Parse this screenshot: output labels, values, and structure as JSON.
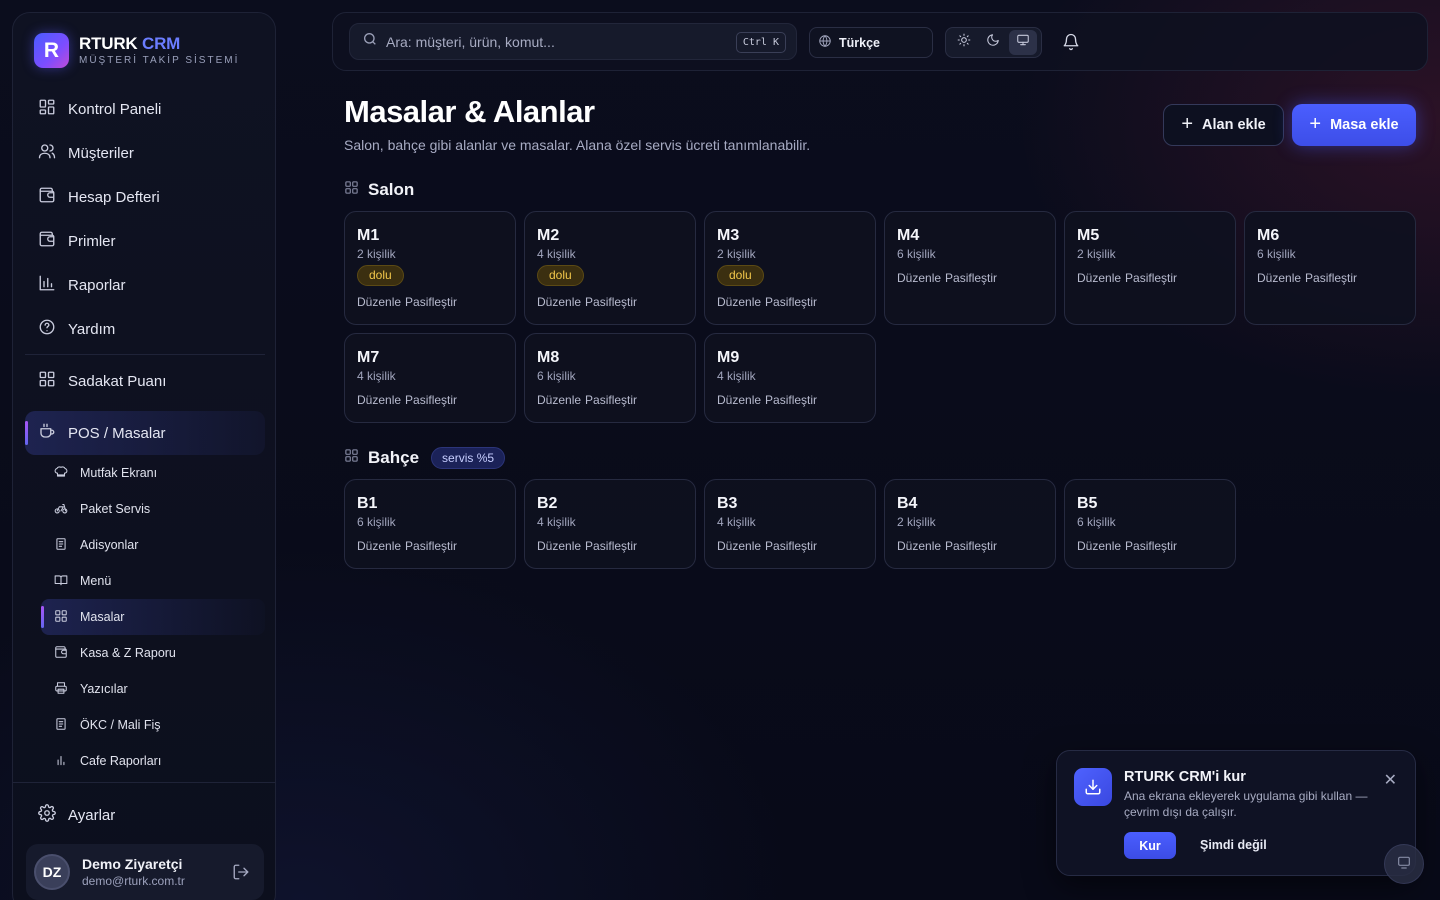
{
  "brand": {
    "logo_letter": "R",
    "name": "RTURK",
    "name_accent": "CRM",
    "subtitle": "MÜŞTERİ TAKİP SİSTEMİ"
  },
  "sidebar": {
    "items": [
      {
        "label": "Kontrol Paneli",
        "icon": "dashboard-icon"
      },
      {
        "label": "Müşteriler",
        "icon": "users-icon"
      },
      {
        "label": "Hesap Defteri",
        "icon": "wallet-icon"
      },
      {
        "label": "Primler",
        "icon": "wallet-icon"
      },
      {
        "label": "Raporlar",
        "icon": "bar-chart-icon"
      },
      {
        "label": "Yardım",
        "icon": "help-icon"
      }
    ],
    "loyalty": {
      "label": "Sadakat Puanı",
      "icon": "grid-icon"
    },
    "pos": {
      "label": "POS / Masalar",
      "icon": "coffee-icon",
      "children": [
        {
          "label": "Mutfak Ekranı",
          "icon": "chef-hat-icon"
        },
        {
          "label": "Paket Servis",
          "icon": "bike-icon"
        },
        {
          "label": "Adisyonlar",
          "icon": "receipt-icon"
        },
        {
          "label": "Menü",
          "icon": "book-icon"
        },
        {
          "label": "Masalar",
          "icon": "grid-icon",
          "active": true
        },
        {
          "label": "Kasa & Z Raporu",
          "icon": "wallet-icon"
        },
        {
          "label": "Yazıcılar",
          "icon": "printer-icon"
        },
        {
          "label": "ÖKC / Mali Fiş",
          "icon": "receipt-icon"
        },
        {
          "label": "Cafe Raporları",
          "icon": "bar-chart-icon"
        }
      ]
    },
    "settings": {
      "label": "Ayarlar",
      "icon": "gear-icon"
    },
    "user": {
      "initials": "DZ",
      "name": "Demo Ziyaretçi",
      "email": "demo@rturk.com.tr"
    }
  },
  "topbar": {
    "search_placeholder": "Ara: müşteri, ürün, komut...",
    "shortcut": "Ctrl K",
    "language": "Türkçe",
    "theme_selected": "system"
  },
  "page": {
    "title": "Masalar & Alanlar",
    "subtitle": "Salon, bahçe gibi alanlar ve masalar. Alana özel servis ücreti tanımlanabilir.",
    "add_area_label": "Alan ekle",
    "add_table_label": "Masa ekle"
  },
  "actions": {
    "edit": "Düzenle",
    "deactivate": "Pasifleştir"
  },
  "areas": [
    {
      "name": "Salon",
      "service": null,
      "tables": [
        {
          "name": "M1",
          "capacity": "2 kişilik",
          "status": "dolu"
        },
        {
          "name": "M2",
          "capacity": "4 kişilik",
          "status": "dolu"
        },
        {
          "name": "M3",
          "capacity": "2 kişilik",
          "status": "dolu"
        },
        {
          "name": "M4",
          "capacity": "6 kişilik",
          "status": null
        },
        {
          "name": "M5",
          "capacity": "2 kişilik",
          "status": null
        },
        {
          "name": "M6",
          "capacity": "6 kişilik",
          "status": null
        },
        {
          "name": "M7",
          "capacity": "4 kişilik",
          "status": null
        },
        {
          "name": "M8",
          "capacity": "6 kişilik",
          "status": null
        },
        {
          "name": "M9",
          "capacity": "4 kişilik",
          "status": null
        }
      ]
    },
    {
      "name": "Bahçe",
      "service": "servis %5",
      "tables": [
        {
          "name": "B1",
          "capacity": "6 kişilik",
          "status": null
        },
        {
          "name": "B2",
          "capacity": "4 kişilik",
          "status": null
        },
        {
          "name": "B3",
          "capacity": "4 kişilik",
          "status": null
        },
        {
          "name": "B4",
          "capacity": "2 kişilik",
          "status": null
        },
        {
          "name": "B5",
          "capacity": "6 kişilik",
          "status": null
        }
      ]
    }
  ],
  "install_toast": {
    "title": "RTURK CRM'i kur",
    "body": "Ana ekrana ekleyerek uygulama gibi kullan — çevrim dışı da çalışır.",
    "install_label": "Kur",
    "later_label": "Şimdi değil"
  },
  "colors": {
    "accent": "#4a5eff",
    "status_busy": "#f3c74b",
    "background": "#080a18"
  }
}
